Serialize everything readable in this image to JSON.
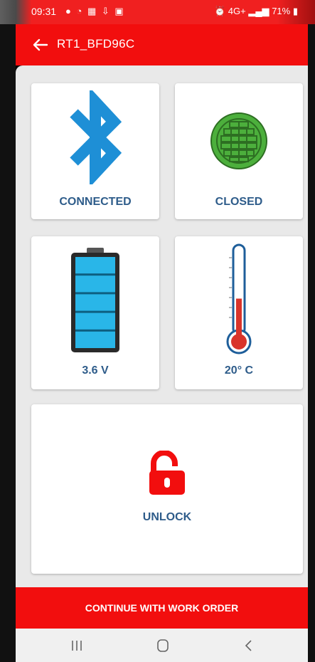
{
  "status_bar": {
    "time": "09:31",
    "battery": "71%",
    "network": "4G+"
  },
  "app_bar": {
    "title": "RT1_BFD96C"
  },
  "tiles": {
    "bluetooth": {
      "label": "CONNECTED"
    },
    "door": {
      "label": "CLOSED"
    },
    "battery": {
      "label": "3.6 V",
      "level": 1.0
    },
    "temperature": {
      "label": "20° C",
      "fill_level": 0.45
    },
    "lock": {
      "label": "UNLOCK"
    }
  },
  "actions": {
    "continue_label": "CONTINUE WITH WORK ORDER"
  },
  "colors": {
    "accent_red": "#f20e0e",
    "label_blue": "#2e5c8a",
    "bluetooth_blue": "#1e8fd6",
    "door_green": "#4caf3c",
    "battery_cyan": "#29b6e8",
    "thermo_red": "#d9342b"
  },
  "icons": {
    "back": "arrow-left-icon",
    "bluetooth": "bluetooth-icon",
    "door": "manhole-cover-icon",
    "battery": "battery-full-icon",
    "temperature": "thermometer-icon",
    "lock": "unlocked-padlock-icon",
    "nav_recent": "recent-apps-icon",
    "nav_home": "home-icon",
    "nav_back": "nav-back-icon"
  }
}
